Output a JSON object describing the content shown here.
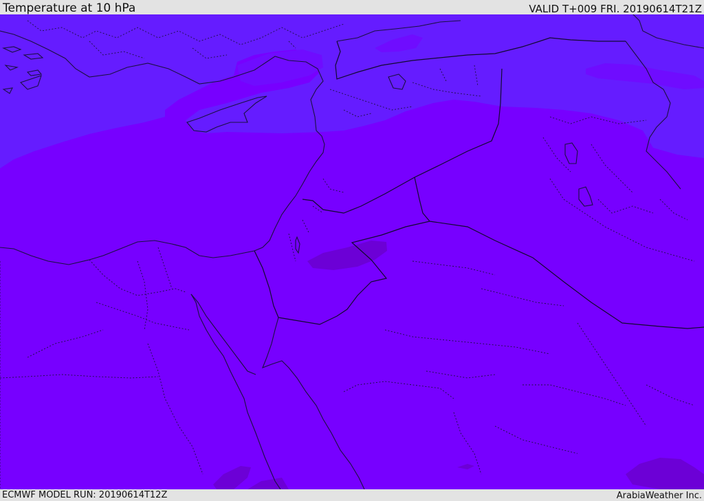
{
  "header": {
    "title": "Temperature at 10 hPa",
    "valid_time": "VALID T+009 FRI. 20190614T21Z"
  },
  "footer": {
    "model_run": "ECMWF MODEL RUN: 20190614T12Z",
    "credit": "ArabiaWeather Inc."
  },
  "map": {
    "colors": {
      "background": "#7700ff",
      "cold_band": "#651cff",
      "warm_patch": "#6c00d6",
      "outline": "#1a1040"
    }
  }
}
